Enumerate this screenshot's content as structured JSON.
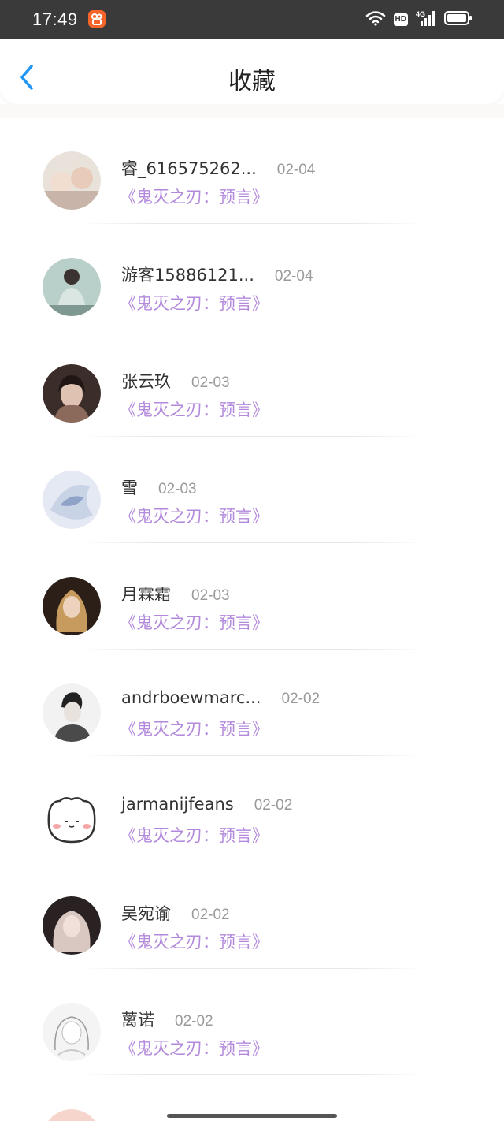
{
  "status_bar": {
    "time": "17:49",
    "app_icon": "kuaishou-icon",
    "hd": "HD",
    "network": "4G"
  },
  "header": {
    "back_icon": "chevron-left-icon",
    "title": "收藏"
  },
  "list": [
    {
      "name": "睿_616575262...",
      "date": "02-04",
      "work": "《鬼灭之刃：预言》",
      "avatar_colors": [
        "#e9e2da",
        "#c8b4a8"
      ]
    },
    {
      "name": "游客15886121...",
      "date": "02-04",
      "work": "《鬼灭之刃：预言》",
      "avatar_colors": [
        "#b9cfc9",
        "#7f9892"
      ]
    },
    {
      "name": "张云玖",
      "date": "02-03",
      "work": "《鬼灭之刃：预言》",
      "avatar_colors": [
        "#3b2e2a",
        "#8b6a5c"
      ]
    },
    {
      "name": "雪",
      "date": "02-03",
      "work": "《鬼灭之刃：预言》",
      "avatar_colors": [
        "#c9d3e6",
        "#8fa2c8"
      ]
    },
    {
      "name": "月霖霜",
      "date": "02-03",
      "work": "《鬼灭之刃：预言》",
      "avatar_colors": [
        "#2c1f18",
        "#c79a5e"
      ]
    },
    {
      "name": "andrboewmarc...",
      "date": "02-02",
      "work": "《鬼灭之刃：预言》",
      "avatar_colors": [
        "#f2f2f2",
        "#4a4a4a"
      ]
    },
    {
      "name": "jarmanijfeans",
      "date": "02-02",
      "work": "《鬼灭之刃：预言》",
      "avatar_colors": [
        "#ffffff",
        "#ffffff"
      ]
    },
    {
      "name": "吴宛谕",
      "date": "02-02",
      "work": "《鬼灭之刃：预言》",
      "avatar_colors": [
        "#2a2222",
        "#d9c7c2"
      ]
    },
    {
      "name": "蓠诺",
      "date": "02-02",
      "work": "《鬼灭之刃：预言》",
      "avatar_colors": [
        "#f4f4f4",
        "#c9c9c9"
      ]
    }
  ],
  "colors": {
    "accent": "#2196f3",
    "work_title": "#b389dc",
    "date": "#9a9a9a"
  }
}
